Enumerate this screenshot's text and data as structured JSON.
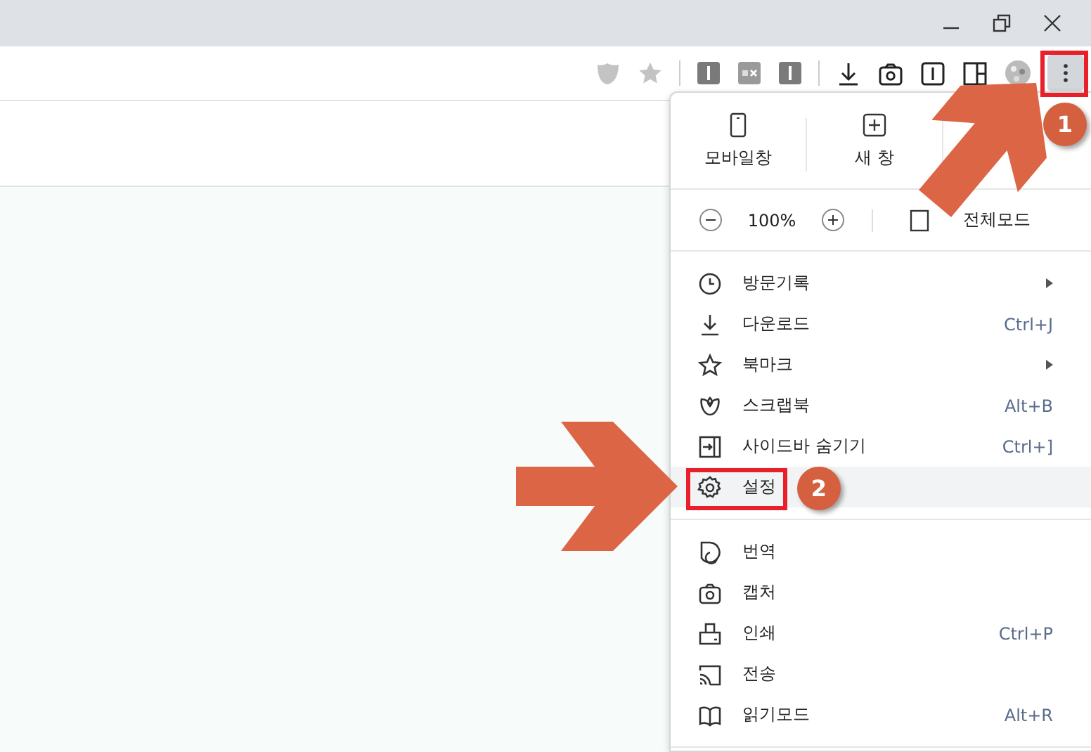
{
  "toolbar": {
    "menu_button_pressed": true
  },
  "menu": {
    "top_buttons": [
      {
        "label": "모바일창"
      },
      {
        "label": "새 창"
      }
    ],
    "zoom": {
      "level_text": "100%",
      "fullscreen_label": "전체모드"
    },
    "sections": [
      [
        {
          "label": "방문기록",
          "submenu": true,
          "selected": false
        },
        {
          "label": "다운로드",
          "shortcut": "Ctrl+J",
          "submenu": false,
          "selected": false
        },
        {
          "label": "북마크",
          "submenu": true,
          "selected": false
        },
        {
          "label": "스크랩북",
          "shortcut": "Alt+B",
          "submenu": false,
          "selected": false
        },
        {
          "label": "사이드바 숨기기",
          "shortcut": "Ctrl+]",
          "submenu": false,
          "selected": false
        },
        {
          "label": "설정",
          "submenu": false,
          "selected": true
        }
      ],
      [
        {
          "label": "번역",
          "submenu": false,
          "selected": false
        },
        {
          "label": "캡처",
          "submenu": false,
          "selected": false
        },
        {
          "label": "인쇄",
          "shortcut": "Ctrl+P",
          "submenu": false,
          "selected": false
        },
        {
          "label": "전송",
          "submenu": false,
          "selected": false
        },
        {
          "label": "읽기모드",
          "shortcut": "Alt+R",
          "submenu": false,
          "selected": false
        }
      ]
    ]
  },
  "annotations": [
    {
      "number": "1"
    },
    {
      "number": "2"
    }
  ]
}
